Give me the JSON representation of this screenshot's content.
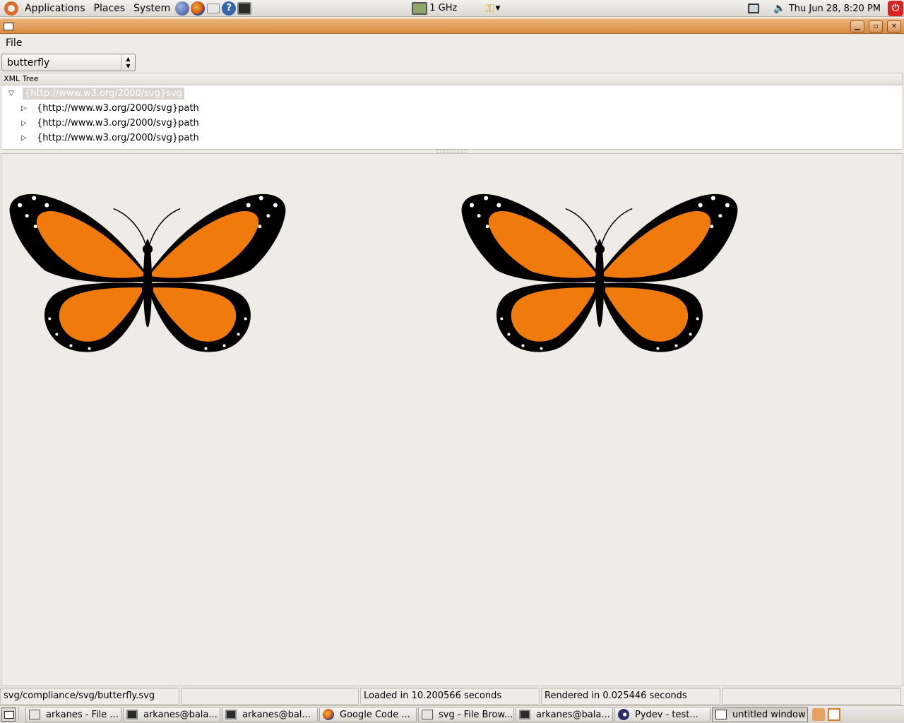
{
  "top_panel": {
    "menus": [
      "Applications",
      "Places",
      "System"
    ],
    "cpu_freq": "1 GHz",
    "clock": "Thu Jun 28,  8:20 PM"
  },
  "menubar": {
    "file": "File"
  },
  "combo": {
    "value": "butterfly"
  },
  "tree": {
    "header": "XML Tree",
    "root": "{http://www.w3.org/2000/svg}svg",
    "children": [
      "{http://www.w3.org/2000/svg}path",
      "{http://www.w3.org/2000/svg}path",
      "{http://www.w3.org/2000/svg}path"
    ]
  },
  "status": {
    "file": "svg/compliance/svg/butterfly.svg",
    "empty": "",
    "loaded": "Loaded in 10.200566 seconds",
    "rendered": "Rendered in 0.025446 seconds"
  },
  "taskbar": {
    "tasks": [
      {
        "label": "arkanes - File ...",
        "icon": "file-manager-icon"
      },
      {
        "label": "arkanes@bala...",
        "icon": "terminal-icon"
      },
      {
        "label": "arkanes@bal...",
        "icon": "terminal-icon"
      },
      {
        "label": "Google Code ...",
        "icon": "firefox-icon"
      },
      {
        "label": "svg - File Brow...",
        "icon": "file-manager-icon"
      },
      {
        "label": "arkanes@bala...",
        "icon": "terminal-icon"
      },
      {
        "label": "Pydev - test...",
        "icon": "eclipse-icon"
      },
      {
        "label": "untitled window",
        "icon": "window-icon"
      }
    ]
  },
  "colors": {
    "titlebar": "#d98b3f",
    "wing_orange": "#f07a0c",
    "wing_black": "#000000",
    "selection": "#d8d4cf"
  }
}
